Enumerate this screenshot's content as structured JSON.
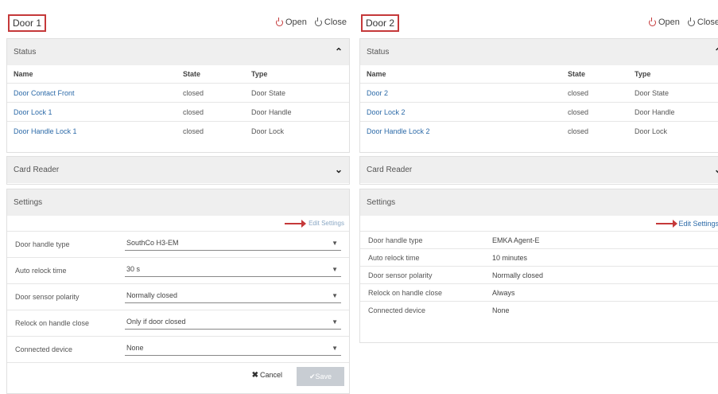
{
  "door1": {
    "title": "Door 1",
    "open_label": "Open",
    "close_label": "Close",
    "status": {
      "header": "Status",
      "columns": [
        "Name",
        "State",
        "Type"
      ],
      "rows": [
        {
          "name": "Door Contact Front",
          "state": "closed",
          "type": "Door State"
        },
        {
          "name": "Door Lock 1",
          "state": "closed",
          "type": "Door Handle"
        },
        {
          "name": "Door Handle Lock 1",
          "state": "closed",
          "type": "Door Lock"
        }
      ]
    },
    "card_reader": "Card Reader",
    "settings": {
      "header": "Settings",
      "edit_label": "Edit Settings",
      "rows": [
        {
          "label": "Door handle type",
          "value": "SouthCo H3-EM"
        },
        {
          "label": "Auto relock time",
          "value": "30 s"
        },
        {
          "label": "Door sensor polarity",
          "value": "Normally closed"
        },
        {
          "label": "Relock on handle close",
          "value": "Only if door closed"
        },
        {
          "label": "Connected device",
          "value": "None"
        }
      ],
      "cancel_label": "Cancel",
      "save_label": "Save"
    }
  },
  "door2": {
    "title": "Door 2",
    "open_label": "Open",
    "close_label": "Close",
    "status": {
      "header": "Status",
      "columns": [
        "Name",
        "State",
        "Type"
      ],
      "rows": [
        {
          "name": "Door 2",
          "state": "closed",
          "type": "Door State"
        },
        {
          "name": "Door Lock 2",
          "state": "closed",
          "type": "Door Handle"
        },
        {
          "name": "Door Handle Lock 2",
          "state": "closed",
          "type": "Door Lock"
        }
      ]
    },
    "card_reader": "Card Reader",
    "settings": {
      "header": "Settings",
      "edit_label": "Edit Settings",
      "rows": [
        {
          "label": "Door handle type",
          "value": "EMKA Agent-E"
        },
        {
          "label": "Auto relock time",
          "value": "10 minutes"
        },
        {
          "label": "Door sensor polarity",
          "value": "Normally closed"
        },
        {
          "label": "Relock on handle close",
          "value": "Always"
        },
        {
          "label": "Connected device",
          "value": "None"
        }
      ]
    }
  },
  "colors": {
    "accent_red": "#c5393a",
    "link_blue": "#2c6aa8",
    "header_bg": "#efefef"
  }
}
